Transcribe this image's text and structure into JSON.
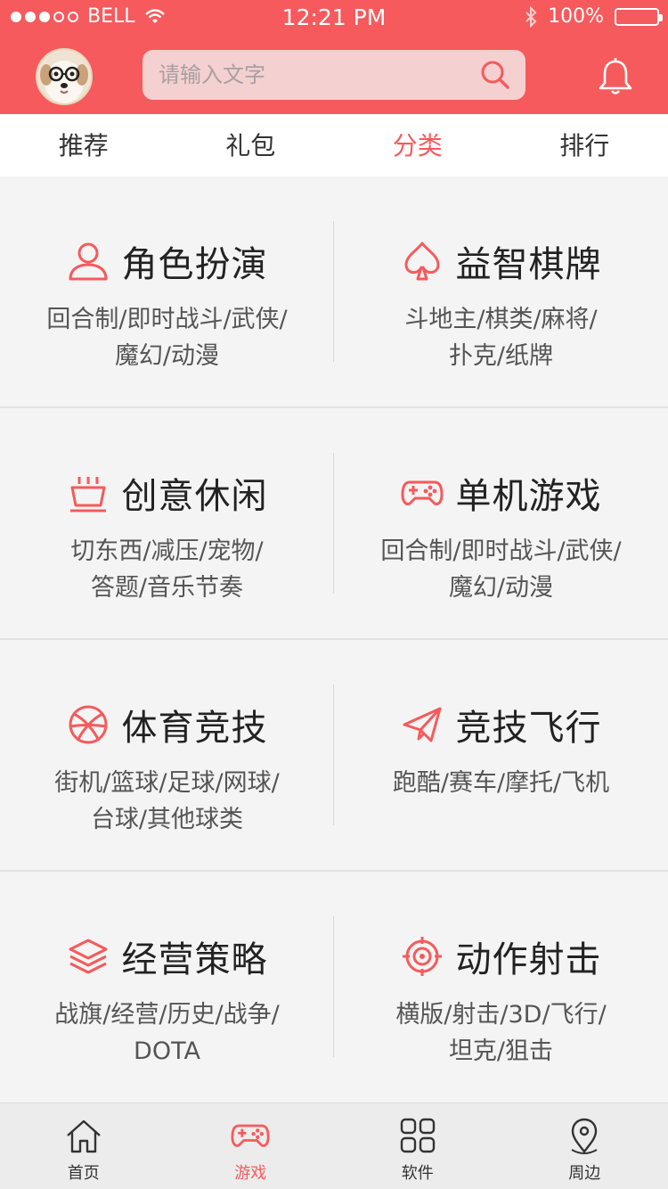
{
  "status_bar": {
    "carrier": "BELL",
    "time": "12:21 PM",
    "battery": "100%"
  },
  "search": {
    "placeholder": "请输入文字"
  },
  "tabs": [
    {
      "label": "推荐",
      "active": false
    },
    {
      "label": "礼包",
      "active": false
    },
    {
      "label": "分类",
      "active": true
    },
    {
      "label": "排行",
      "active": false
    }
  ],
  "categories": [
    {
      "icon": "user-icon",
      "title": "角色扮演",
      "line1": "回合制/即时战斗/武侠/",
      "line2": "魔幻/动漫"
    },
    {
      "icon": "spade-icon",
      "title": "益智棋牌",
      "line1": "斗地主/棋类/麻将/",
      "line2": "扑克/纸牌"
    },
    {
      "icon": "basket-icon",
      "title": "创意休闲",
      "line1": "切东西/减压/宠物/",
      "line2": "答题/音乐节奏"
    },
    {
      "icon": "gamepad-icon",
      "title": "单机游戏",
      "line1": "回合制/即时战斗/武侠/",
      "line2": "魔幻/动漫"
    },
    {
      "icon": "ball-icon",
      "title": "体育竞技",
      "line1": "街机/篮球/足球/网球/",
      "line2": "台球/其他球类"
    },
    {
      "icon": "paper-plane-icon",
      "title": "竞技飞行",
      "line1": "跑酷/赛车/摩托/飞机",
      "line2": ""
    },
    {
      "icon": "layers-icon",
      "title": "经营策略",
      "line1": "战旗/经营/历史/战争/",
      "line2": "DOTA"
    },
    {
      "icon": "crosshair-icon",
      "title": "动作射击",
      "line1": "横版/射击/3D/飞行/",
      "line2": "坦克/狙击"
    }
  ],
  "bottom_nav": [
    {
      "label": "首页",
      "icon": "home-icon",
      "active": false
    },
    {
      "label": "游戏",
      "icon": "gamepad-icon",
      "active": true
    },
    {
      "label": "软件",
      "icon": "apps-grid-icon",
      "active": false
    },
    {
      "label": "周边",
      "icon": "location-pin-icon",
      "active": false
    }
  ],
  "colors": {
    "accent": "#f65a5c",
    "background": "#f4f4f4",
    "text": "#222222"
  }
}
